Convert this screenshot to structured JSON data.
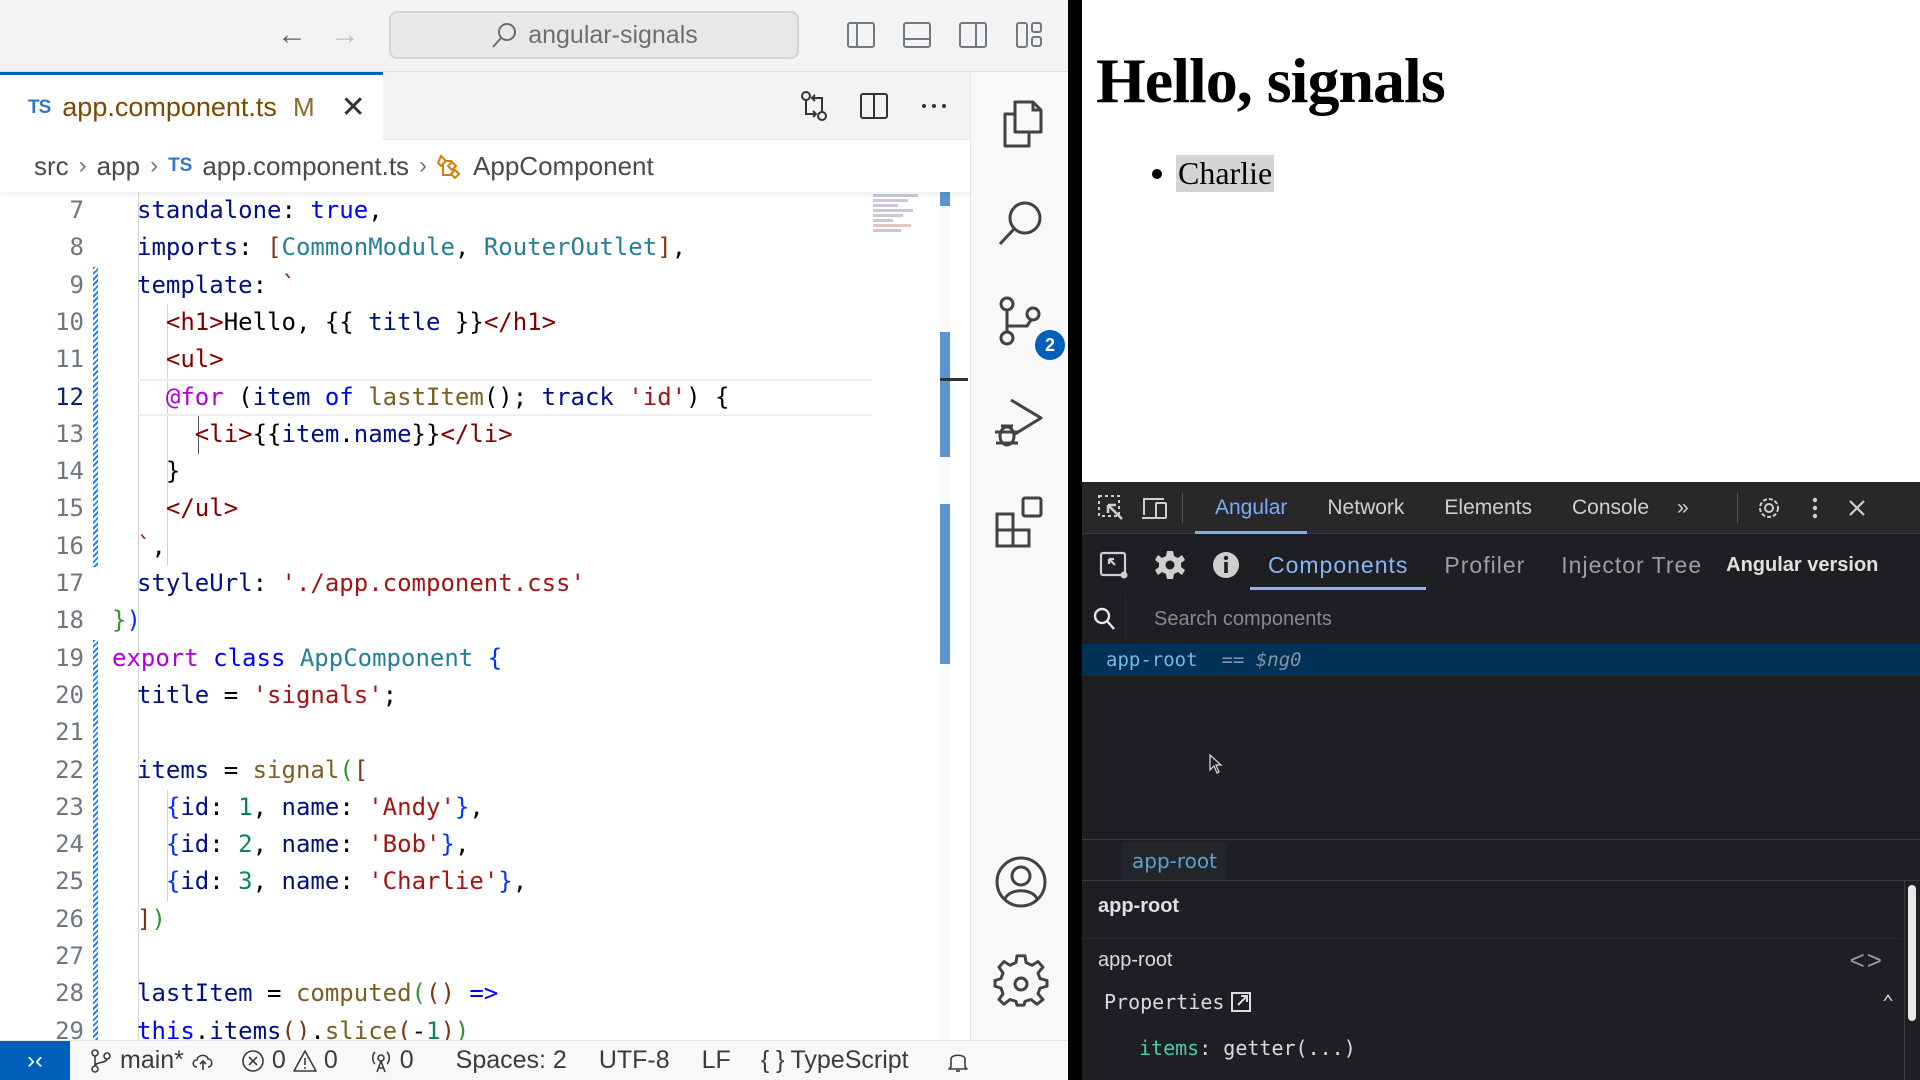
{
  "vscode": {
    "title_search": "angular-signals",
    "tab": {
      "lang_badge": "TS",
      "filename": "app.component.ts",
      "status": "M"
    },
    "breadcrumb": [
      "src",
      "app",
      "app.component.ts",
      "AppComponent"
    ],
    "breadcrumb_lang_badge": "TS",
    "code": {
      "active_line": 12,
      "lines": [
        {
          "n": 7,
          "html": "<span class='prop'>standalone</span><span class='pun'>: </span><span class='kw'>true</span><span class='pun'>,</span>"
        },
        {
          "n": 8,
          "html": "<span class='prop'>imports</span><span class='pun'>: </span><span class='b3'>[</span><span class='type'>CommonModule</span><span class='pun'>, </span><span class='type'>RouterOutlet</span><span class='b3'>]</span><span class='pun'>,</span>"
        },
        {
          "n": 9,
          "html": "<span class='prop'>template</span><span class='pun'>: </span><span class='str'>`</span>"
        },
        {
          "n": 10,
          "html": "  <span class='tag'>&lt;h1&gt;</span><span class='pun'>Hello, </span><span class='pun'>{{ </span><span class='prop'>title</span><span class='pun'> }}</span><span class='tag'>&lt;/h1&gt;</span>"
        },
        {
          "n": 11,
          "html": "  <span class='tag'>&lt;ul&gt;</span>"
        },
        {
          "n": 12,
          "html": "  <span class='kw2'>@for</span><span class='pun'> (</span><span class='prop'>item</span> <span class='kw'>of</span> <span class='fn'>lastItem</span><span class='pun'>(); </span><span class='prop'>track</span> <span class='str'>'id'</span><span class='pun'>) {</span>"
        },
        {
          "n": 13,
          "html": "    <span class='tag'>&lt;li&gt;</span><span class='pun'>{{</span><span class='prop'>item</span><span class='pun'>.</span><span class='prop'>name</span><span class='pun'>}}</span><span class='tag'>&lt;/li&gt;</span>"
        },
        {
          "n": 14,
          "html": "  <span class='pun'>}</span>"
        },
        {
          "n": 15,
          "html": "  <span class='tag'>&lt;/ul&gt;</span>"
        },
        {
          "n": 16,
          "html": "<span class='str'>`</span><span class='pun'>,</span>"
        },
        {
          "n": 17,
          "html": "<span class='prop'>styleUrl</span><span class='pun'>: </span><span class='str'>'./app.component.css'</span>"
        },
        {
          "n": 18,
          "html": "<span class='b2'>}</span><span class='b1'>)</span>",
          "outdent": true
        },
        {
          "n": 19,
          "html": "<span class='kw2'>export</span> <span class='kw'>class</span> <span class='type'>AppComponent</span> <span class='b1'>{</span>",
          "outdent": true
        },
        {
          "n": 20,
          "html": "<span class='prop'>title</span><span class='pun'> = </span><span class='str'>'signals'</span><span class='pun'>;</span>"
        },
        {
          "n": 21,
          "html": ""
        },
        {
          "n": 22,
          "html": "<span class='prop'>items</span><span class='pun'> = </span><span class='fn'>signal</span><span class='b2'>(</span><span class='b3'>[</span>"
        },
        {
          "n": 23,
          "html": "  <span class='b1'>{</span><span class='prop'>id</span><span class='pun'>: </span><span class='num'>1</span><span class='pun'>, </span><span class='prop'>name</span><span class='pun'>: </span><span class='str'>'Andy'</span><span class='b1'>}</span><span class='pun'>,</span>"
        },
        {
          "n": 24,
          "html": "  <span class='b1'>{</span><span class='prop'>id</span><span class='pun'>: </span><span class='num'>2</span><span class='pun'>, </span><span class='prop'>name</span><span class='pun'>: </span><span class='str'>'Bob'</span><span class='b1'>}</span><span class='pun'>,</span>"
        },
        {
          "n": 25,
          "html": "  <span class='b1'>{</span><span class='prop'>id</span><span class='pun'>: </span><span class='num'>3</span><span class='pun'>, </span><span class='prop'>name</span><span class='pun'>: </span><span class='str'>'Charlie'</span><span class='b1'>}</span><span class='pun'>,</span>"
        },
        {
          "n": 26,
          "html": "<span class='b3'>]</span><span class='b2'>)</span>"
        },
        {
          "n": 27,
          "html": ""
        },
        {
          "n": 28,
          "html": "<span class='prop'>lastItem</span><span class='pun'> = </span><span class='fn'>computed</span><span class='b2'>(</span><span class='b3'>()</span> <span class='kw'>=&gt;</span>"
        },
        {
          "n": 29,
          "html": "<span class='kw'>this</span><span class='pun'>.</span><span class='prop'>items</span><span class='b3'>()</span><span class='pun'>.</span><span class='fn'>slice</span><span class='b3'>(</span><span class='pun'>-</span><span class='num'>1</span><span class='b3'>)</span><span class='b2'>)</span>"
        }
      ]
    },
    "scm_badge": "2",
    "status": {
      "branch": "main*",
      "errors": "0",
      "warnings": "0",
      "ports": "0",
      "spaces": "Spaces: 2",
      "encoding": "UTF-8",
      "eol": "LF",
      "language": "TypeScript"
    }
  },
  "browser": {
    "preview": {
      "heading": "Hello, signals",
      "list_items": [
        "Charlie"
      ]
    },
    "devtools": {
      "tabs": [
        "Angular",
        "Network",
        "Elements",
        "Console"
      ],
      "active_tab": "Angular",
      "more_tabs": "»",
      "ng_tabs": [
        "Components",
        "Profiler",
        "Injector Tree"
      ],
      "ng_active_tab": "Components",
      "angular_version_label": "Angular version",
      "search_placeholder": "Search components",
      "tree_node": {
        "name": "app-root",
        "ref": "== $ng0"
      },
      "crumb": "app-root",
      "detail_title": "app-root",
      "detail_component": "app-root",
      "properties_label": "Properties",
      "property_key": "items",
      "property_value": ": getter(...)"
    }
  }
}
